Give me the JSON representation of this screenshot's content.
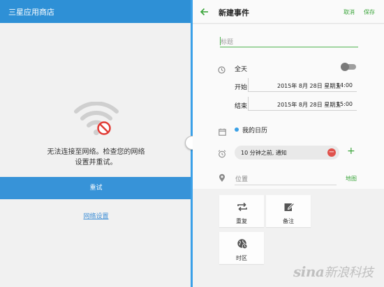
{
  "store": {
    "title": "三星应用商店",
    "error_line1": "无法连接至网络。检查您的网络",
    "error_line2": "设置并重试。",
    "retry_label": "重试",
    "network_settings_label": "网络设置"
  },
  "calendar": {
    "title": "新建事件",
    "cancel_label": "取消",
    "save_label": "保存",
    "title_placeholder": "标题",
    "all_day_label": "全天",
    "all_day_on": false,
    "start_label": "开始",
    "start_date": "2015年 8月 28日 星期五",
    "start_time": "14:00",
    "end_label": "结束",
    "end_date": "2015年 8月 28日 星期五",
    "end_time": "15:00",
    "calendar_name": "我的日历",
    "reminder": "10 分钟之前, 通知",
    "location_placeholder": "位置",
    "map_label": "地图",
    "tiles": [
      {
        "label": "重复",
        "icon": "repeat-icon"
      },
      {
        "label": "备注",
        "icon": "note-icon"
      },
      {
        "label": "时区",
        "icon": "timezone-icon"
      }
    ]
  },
  "watermark": {
    "latin": "sina",
    "chinese": "新浪科技"
  },
  "colors": {
    "store_bar": "#2e90d6",
    "retry_button": "#3793d8",
    "accent_green": "#3aa53a",
    "calendar_dot": "#39a0e6",
    "remove_red": "#e0524c",
    "divider": "#3aa0e8"
  }
}
